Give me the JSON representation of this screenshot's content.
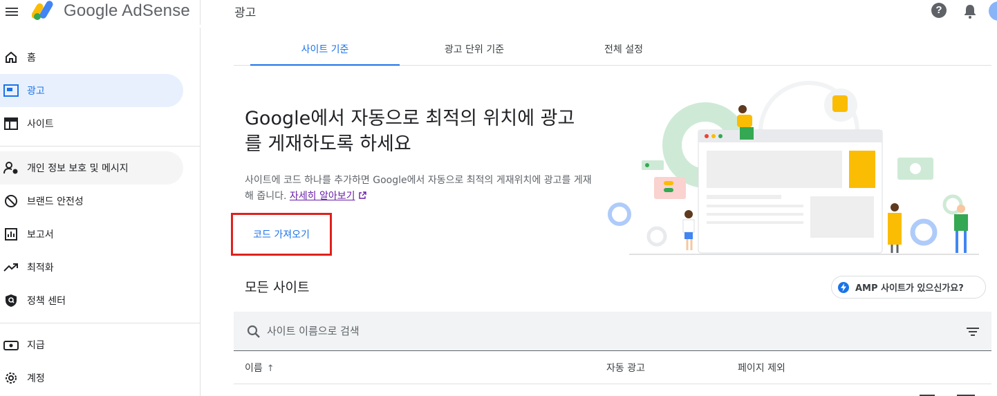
{
  "app": {
    "product_name": "Google AdSense",
    "page_title": "광고"
  },
  "topbar": {
    "help_icon": "help-icon",
    "notifications_icon": "bell-icon"
  },
  "sidebar": {
    "items": [
      {
        "label": "홈",
        "icon": "home-icon"
      },
      {
        "label": "광고",
        "icon": "ads-icon",
        "active": true
      },
      {
        "label": "사이트",
        "icon": "sites-icon"
      },
      {
        "label": "개인 정보 보호 및 메시지",
        "icon": "privacy-icon"
      },
      {
        "label": "브랜드 안전성",
        "icon": "block-icon"
      },
      {
        "label": "보고서",
        "icon": "reports-icon"
      },
      {
        "label": "최적화",
        "icon": "trending-icon"
      },
      {
        "label": "정책 센터",
        "icon": "shield-icon"
      },
      {
        "label": "지급",
        "icon": "payments-icon"
      },
      {
        "label": "계정",
        "icon": "settings-icon"
      }
    ]
  },
  "tabs": [
    {
      "label": "사이트 기준",
      "active": true
    },
    {
      "label": "광고 단위 기준"
    },
    {
      "label": "전체 설정"
    }
  ],
  "hero": {
    "headline": "Google에서 자동으로 최적의 위치에 광고를 게재하도록 하세요",
    "description": "사이트에 코드 하나를 추가하면 Google에서 자동으로 최적의 게재위치에 광고를 게재해 줍니다.",
    "learn_more": "자세히 알아보기",
    "get_code_button": "코드 가져오기"
  },
  "sites_section": {
    "title": "모든 사이트",
    "amp_button": "AMP 사이트가 있으신가요?",
    "search_placeholder": "사이트 이름으로 검색",
    "columns": [
      "이름",
      "자동 광고",
      "페이지 제외"
    ],
    "sort_indicator": "↑"
  },
  "colors": {
    "accent": "#1a73e8",
    "highlight_box": "#e0201c",
    "active_nav_bg": "#e8f0fe"
  }
}
